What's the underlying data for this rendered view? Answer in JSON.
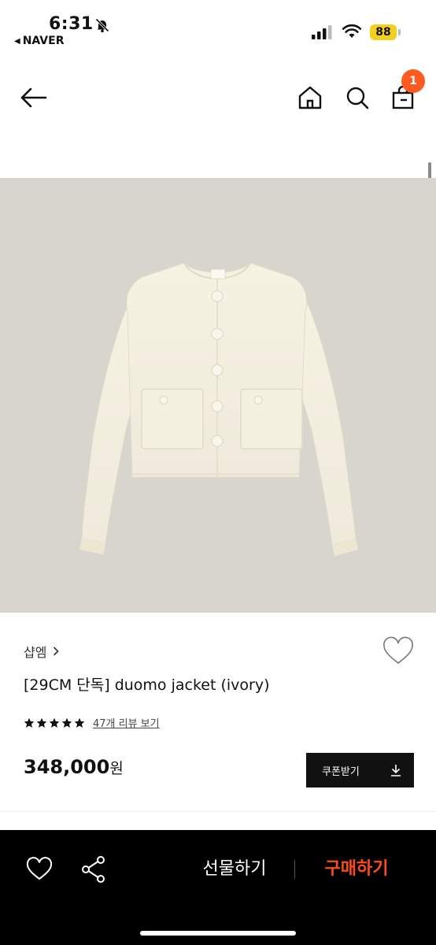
{
  "status_bar": {
    "time": "6:31",
    "back_app": "NAVER",
    "battery": "88"
  },
  "header": {
    "cart_count": "1"
  },
  "product": {
    "brand": "샵엠",
    "title": "[29CM 단독] duomo jacket (ivory)",
    "rating_stars": 5,
    "review_link": "47개 리뷰 보기",
    "price": "348,000",
    "price_unit": "원",
    "coupon_label": "쿠폰받기"
  },
  "bottom_bar": {
    "gift_label": "선물하기",
    "buy_label": "구매하기"
  },
  "colors": {
    "accent": "#ff4b16",
    "badge": "#ff5a1f",
    "image_bg": "#d8d5cf",
    "jacket": "#f3efdf"
  }
}
